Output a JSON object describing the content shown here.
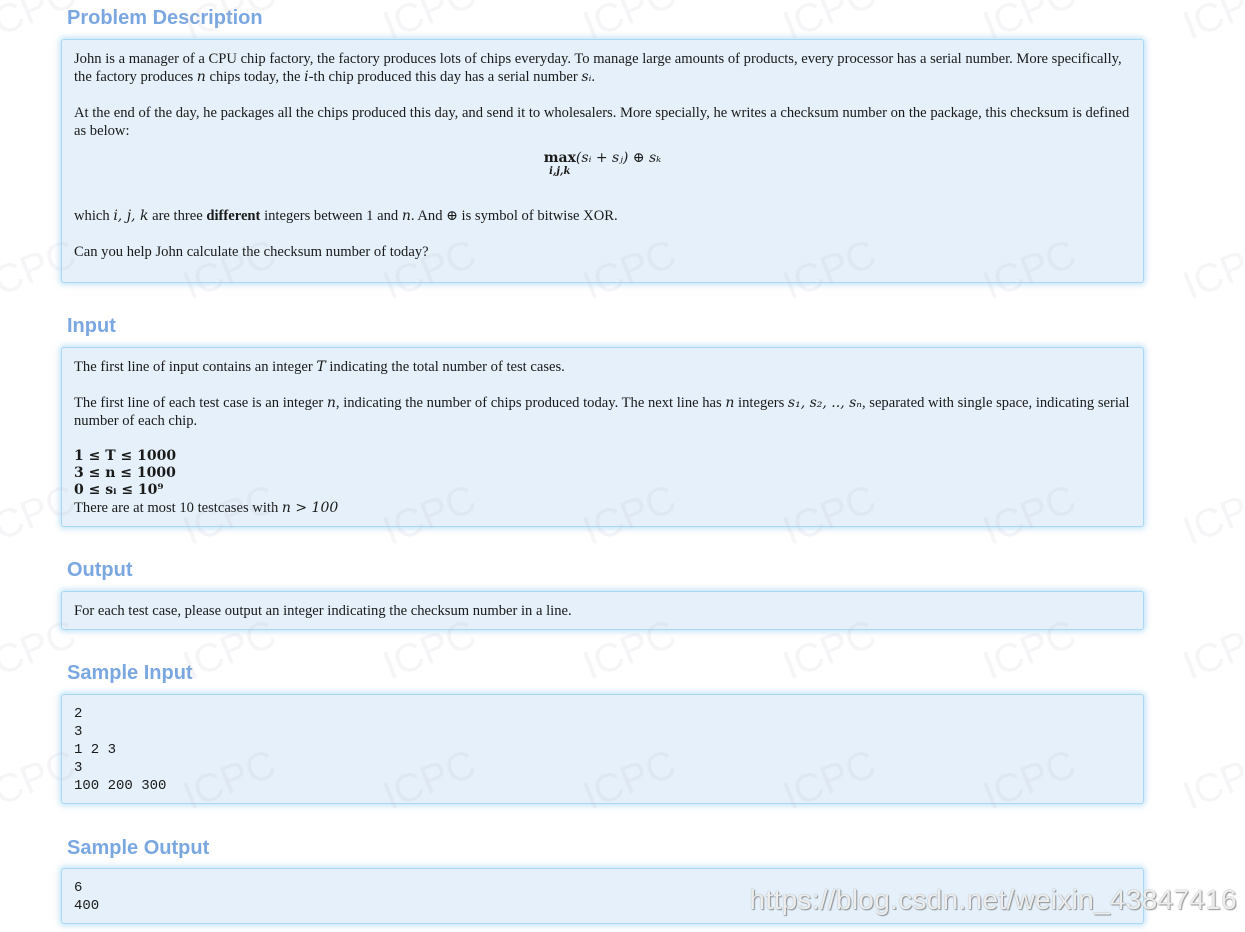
{
  "sections": {
    "problem": {
      "title": "Problem Description",
      "p1_a": "John is a manager of a CPU chip factory, the factory produces lots of chips everyday. To manage large amounts of products, every processor has a serial number. More specifically, the factory produces ",
      "p1_b": " chips today, the ",
      "p1_c": "-th chip produced this day has a serial number ",
      "p1_d": ".",
      "p2": "At the end of the day, he packages all the chips produced this day, and send it to wholesalers. More specially, he writes a checksum number on the package, this checksum is defined as below:",
      "formula_op": "max",
      "formula_sub": "i,j,k",
      "formula_body": "(sᵢ + sⱼ) ⊕ sₖ",
      "p3_a": "which ",
      "p3_vars": "i, j, k",
      "p3_b": " are three ",
      "p3_bold": "different",
      "p3_c": " integers between 1 and ",
      "p3_d": ". And ",
      "p3_xor": "⊕",
      "p3_e": " is symbol of bitwise XOR.",
      "p4": "Can you help John calculate the checksum number of today?"
    },
    "input": {
      "title": "Input",
      "p1_a": "The first line of input contains an integer ",
      "p1_var": "T",
      "p1_b": " indicating the total number of test cases.",
      "p2_a": "The first line of each test case is an integer ",
      "p2_var": "n",
      "p2_b": ", indicating the number of chips produced today. The next line has ",
      "p2_c": " integers ",
      "p2_seq": "s₁, s₂, .., sₙ",
      "p2_d": ", separated with single space, indicating serial number of each chip.",
      "c1": "1 ≤ T ≤ 1000",
      "c2": "3 ≤ n ≤ 1000",
      "c3": "0 ≤ sᵢ ≤ 10⁹",
      "c4_a": "There are at most 10 testcases with ",
      "c4_math": "n > 100"
    },
    "output": {
      "title": "Output",
      "text": "For each test case, please output an integer indicating the checksum number in a line."
    },
    "sample_input": {
      "title": "Sample Input",
      "text": "2\n3\n1 2 3\n3\n100 200 300"
    },
    "sample_output": {
      "title": "Sample Output",
      "text": "6\n400"
    }
  },
  "vars": {
    "n": "n",
    "i": "i",
    "si": "sᵢ"
  },
  "watermark": {
    "text": "https://blog.csdn.net/weixin_43847416",
    "tile": "ICPC"
  },
  "colors": {
    "title": "#7ba7e1",
    "box_bg": "#e5f0fa",
    "box_border": "#a9d8f5"
  }
}
